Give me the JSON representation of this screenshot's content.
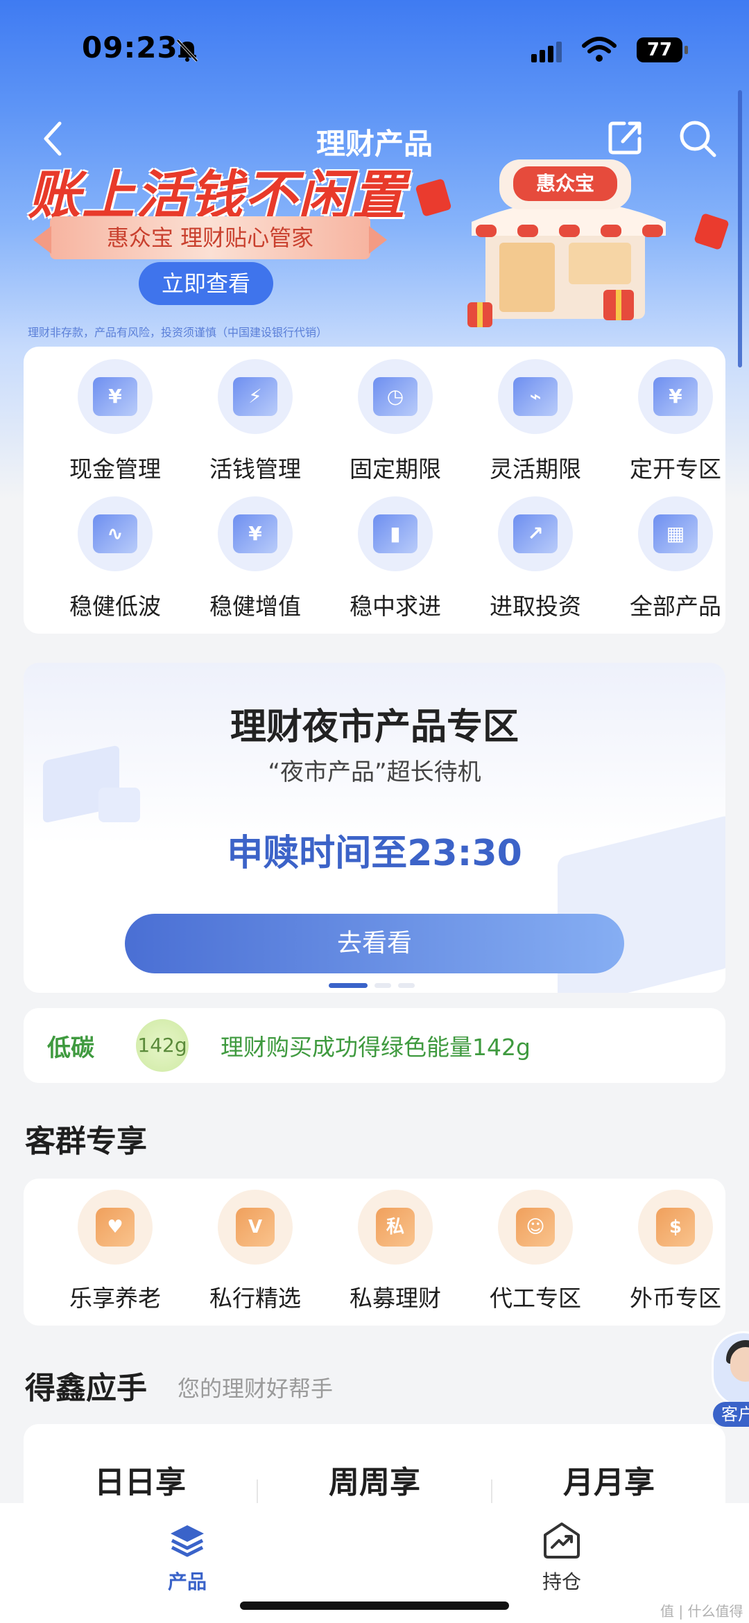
{
  "status_bar": {
    "time": "09:23",
    "battery": "77"
  },
  "navbar": {
    "title": "理财产品"
  },
  "banner": {
    "headline": "账上活钱不闲置",
    "ribbon": "惠众宝 理财贴心管家",
    "button": "立即查看",
    "store_sign": "惠众宝",
    "disclaimer": "理财非存款，产品有风险，投资须谨慎（中国建设银行代销）"
  },
  "categories": [
    {
      "label": "现金管理",
      "icon": "cash-card-icon",
      "glyph": "¥"
    },
    {
      "label": "活钱管理",
      "icon": "lightning-shield-icon",
      "glyph": "⚡"
    },
    {
      "label": "固定期限",
      "icon": "clock-shield-icon",
      "glyph": "◷"
    },
    {
      "label": "灵活期限",
      "icon": "trend-card-icon",
      "glyph": "⌁"
    },
    {
      "label": "定开专区",
      "icon": "calendar-yuan-icon",
      "glyph": "¥"
    },
    {
      "label": "稳健低波",
      "icon": "wave-chart-icon",
      "glyph": "∿"
    },
    {
      "label": "稳健增值",
      "icon": "house-yuan-icon",
      "glyph": "¥"
    },
    {
      "label": "稳中求进",
      "icon": "bar-chart-icon",
      "glyph": "▮"
    },
    {
      "label": "进取投资",
      "icon": "growth-coin-icon",
      "glyph": "↗"
    },
    {
      "label": "全部产品",
      "icon": "grid-blocks-icon",
      "glyph": "▦"
    }
  ],
  "night_market": {
    "title": "理财夜市产品专区",
    "subtitle": "“夜市产品”超长待机",
    "time_text": "申赎时间至23:30",
    "button": "去看看"
  },
  "carbon": {
    "label": "低碳",
    "badge": "142g",
    "text": "理财购买成功得绿色能量142g"
  },
  "customer_section": {
    "title": "客群专享",
    "items": [
      {
        "label": "乐享养老",
        "icon": "elder-heart-icon",
        "glyph": "♥"
      },
      {
        "label": "私行精选",
        "icon": "private-house-icon",
        "glyph": "V"
      },
      {
        "label": "私募理财",
        "icon": "private-bag-icon",
        "glyph": "私"
      },
      {
        "label": "代工专区",
        "icon": "worker-icon",
        "glyph": "☺"
      },
      {
        "label": "外币专区",
        "icon": "dollar-coin-icon",
        "glyph": "$"
      }
    ]
  },
  "helper_section": {
    "title": "得鑫应手",
    "subtitle": "您的理财好帮手",
    "tabs": [
      "日日享",
      "周周享",
      "月月享"
    ]
  },
  "floating_service": {
    "label": "客户"
  },
  "bottom_nav": [
    {
      "label": "产品",
      "icon": "layers-icon",
      "active": true
    },
    {
      "label": "持仓",
      "icon": "holding-chart-icon",
      "active": false
    }
  ],
  "watermark": "值 | 什么值得买",
  "colors": {
    "primary": "#3a63c9",
    "banner_red": "#e83a2a",
    "green": "#3f9a3f",
    "orange": "#f0a05c"
  }
}
